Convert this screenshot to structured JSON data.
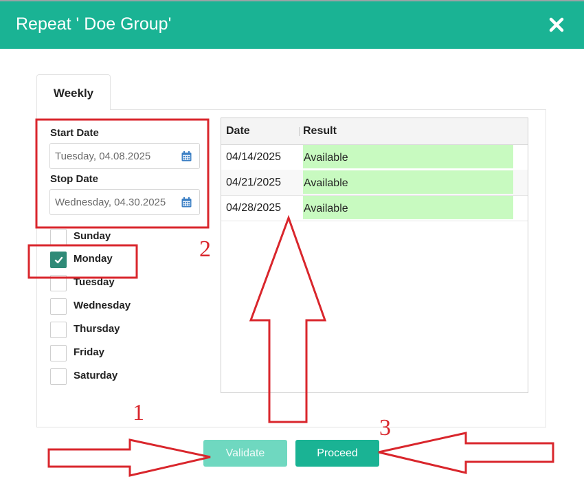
{
  "dialog": {
    "title": "Repeat ' Doe Group'",
    "close_icon": "close-icon"
  },
  "tabs": [
    {
      "label": "Weekly"
    }
  ],
  "form": {
    "start_date": {
      "label": "Start Date",
      "value": "Tuesday, 04.08.2025"
    },
    "stop_date": {
      "label": "Stop Date",
      "value": "Wednesday, 04.30.2025"
    }
  },
  "days": [
    {
      "label": "Sunday",
      "checked": false
    },
    {
      "label": "Monday",
      "checked": true
    },
    {
      "label": "Tuesday",
      "checked": false
    },
    {
      "label": "Wednesday",
      "checked": false
    },
    {
      "label": "Thursday",
      "checked": false
    },
    {
      "label": "Friday",
      "checked": false
    },
    {
      "label": "Saturday",
      "checked": false
    }
  ],
  "results": {
    "columns": [
      "Date",
      "Result"
    ],
    "rows": [
      {
        "date": "04/14/2025",
        "result": "Available"
      },
      {
        "date": "04/21/2025",
        "result": "Available"
      },
      {
        "date": "04/28/2025",
        "result": "Available"
      }
    ]
  },
  "buttons": {
    "validate": "Validate",
    "proceed": "Proceed"
  },
  "annotations": {
    "n1": "1",
    "n2": "2",
    "n3": "3"
  },
  "colors": {
    "header": "#1ab394",
    "available": "#c8fac0",
    "annotation": "#d9262c",
    "checked": "#2f8a77"
  }
}
